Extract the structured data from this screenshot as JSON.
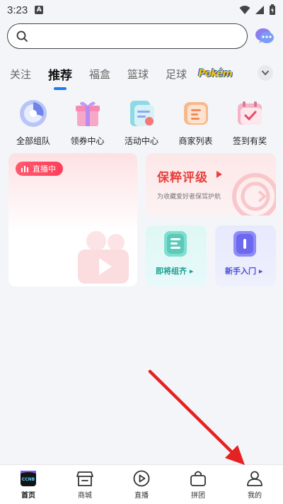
{
  "status_bar": {
    "time": "3:23",
    "badge": "A"
  },
  "search": {
    "placeholder": ""
  },
  "tabs": [
    {
      "label": "关注"
    },
    {
      "label": "推荐"
    },
    {
      "label": "福盒"
    },
    {
      "label": "篮球"
    },
    {
      "label": "足球"
    },
    {
      "label": "Pokém"
    }
  ],
  "shortcuts": [
    {
      "label": "全部组队",
      "icon": "team-icon"
    },
    {
      "label": "领券中心",
      "icon": "gift-icon"
    },
    {
      "label": "活动中心",
      "icon": "activity-icon"
    },
    {
      "label": "商家列表",
      "icon": "merchant-list-icon"
    },
    {
      "label": "签到有奖",
      "icon": "checkin-calendar-icon"
    }
  ],
  "live_card": {
    "badge": "直播中"
  },
  "grade_card": {
    "title": "保粹评级",
    "subtitle": "为收藏爱好者保驾护航"
  },
  "mini_cards": [
    {
      "label": "即将组齐 ▸"
    },
    {
      "label": "新手入门 ▸"
    }
  ],
  "bottom_nav": [
    {
      "label": "首页",
      "icon": "home-ccnb-icon"
    },
    {
      "label": "商城",
      "icon": "shop-icon"
    },
    {
      "label": "直播",
      "icon": "live-play-icon"
    },
    {
      "label": "拼团",
      "icon": "group-bag-icon"
    },
    {
      "label": "我的",
      "icon": "profile-icon"
    }
  ],
  "colors": {
    "accent": "#1e7bf2",
    "live_red": "#ff3f5a",
    "grade_red": "#e8413e",
    "arrow_red": "#e52222"
  }
}
